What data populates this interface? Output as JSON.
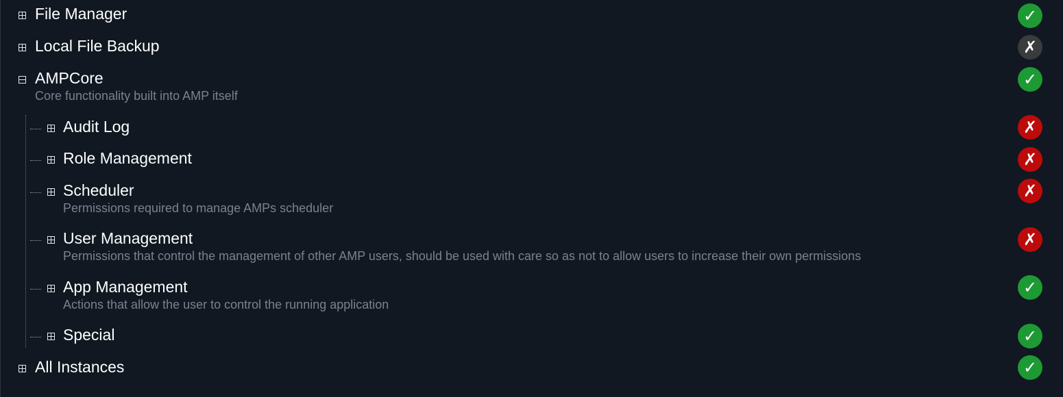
{
  "permissions": {
    "file_manager": {
      "label": "File Manager",
      "status": "allow",
      "glyph": "✓",
      "expander": "expand"
    },
    "local_file_backup": {
      "label": "Local File Backup",
      "status": "unset",
      "glyph": "✗",
      "expander": "expand"
    },
    "ampcore": {
      "label": "AMPCore",
      "description": "Core functionality built into AMP itself",
      "status": "allow",
      "glyph": "✓",
      "expander": "collapse",
      "children": {
        "audit_log": {
          "label": "Audit Log",
          "status": "deny",
          "glyph": "✗",
          "expander": "expand"
        },
        "role_management": {
          "label": "Role Management",
          "status": "deny",
          "glyph": "✗",
          "expander": "expand"
        },
        "scheduler": {
          "label": "Scheduler",
          "description": "Permissions required to manage AMPs scheduler",
          "status": "deny",
          "glyph": "✗",
          "expander": "expand"
        },
        "user_management": {
          "label": "User Management",
          "description": "Permissions that control the management of other AMP users, should be used with care so as not to allow users to increase their own permissions",
          "status": "deny",
          "glyph": "✗",
          "expander": "expand"
        },
        "app_management": {
          "label": "App Management",
          "description": "Actions that allow the user to control the running application",
          "status": "allow",
          "glyph": "✓",
          "expander": "expand"
        },
        "special": {
          "label": "Special",
          "status": "allow",
          "glyph": "✓",
          "expander": "expand"
        }
      }
    },
    "all_instances": {
      "label": "All Instances",
      "status": "allow",
      "glyph": "✓",
      "expander": "expand"
    }
  },
  "colors": {
    "background": "#111822",
    "allow": "#1e9a34",
    "deny": "#bd0b0b",
    "unset": "#3a3b3d",
    "description": "#7b828c"
  },
  "icons": {
    "expand": "plus-square-icon",
    "collapse": "minus-square-icon",
    "allow": "check-icon",
    "deny": "cross-icon"
  }
}
